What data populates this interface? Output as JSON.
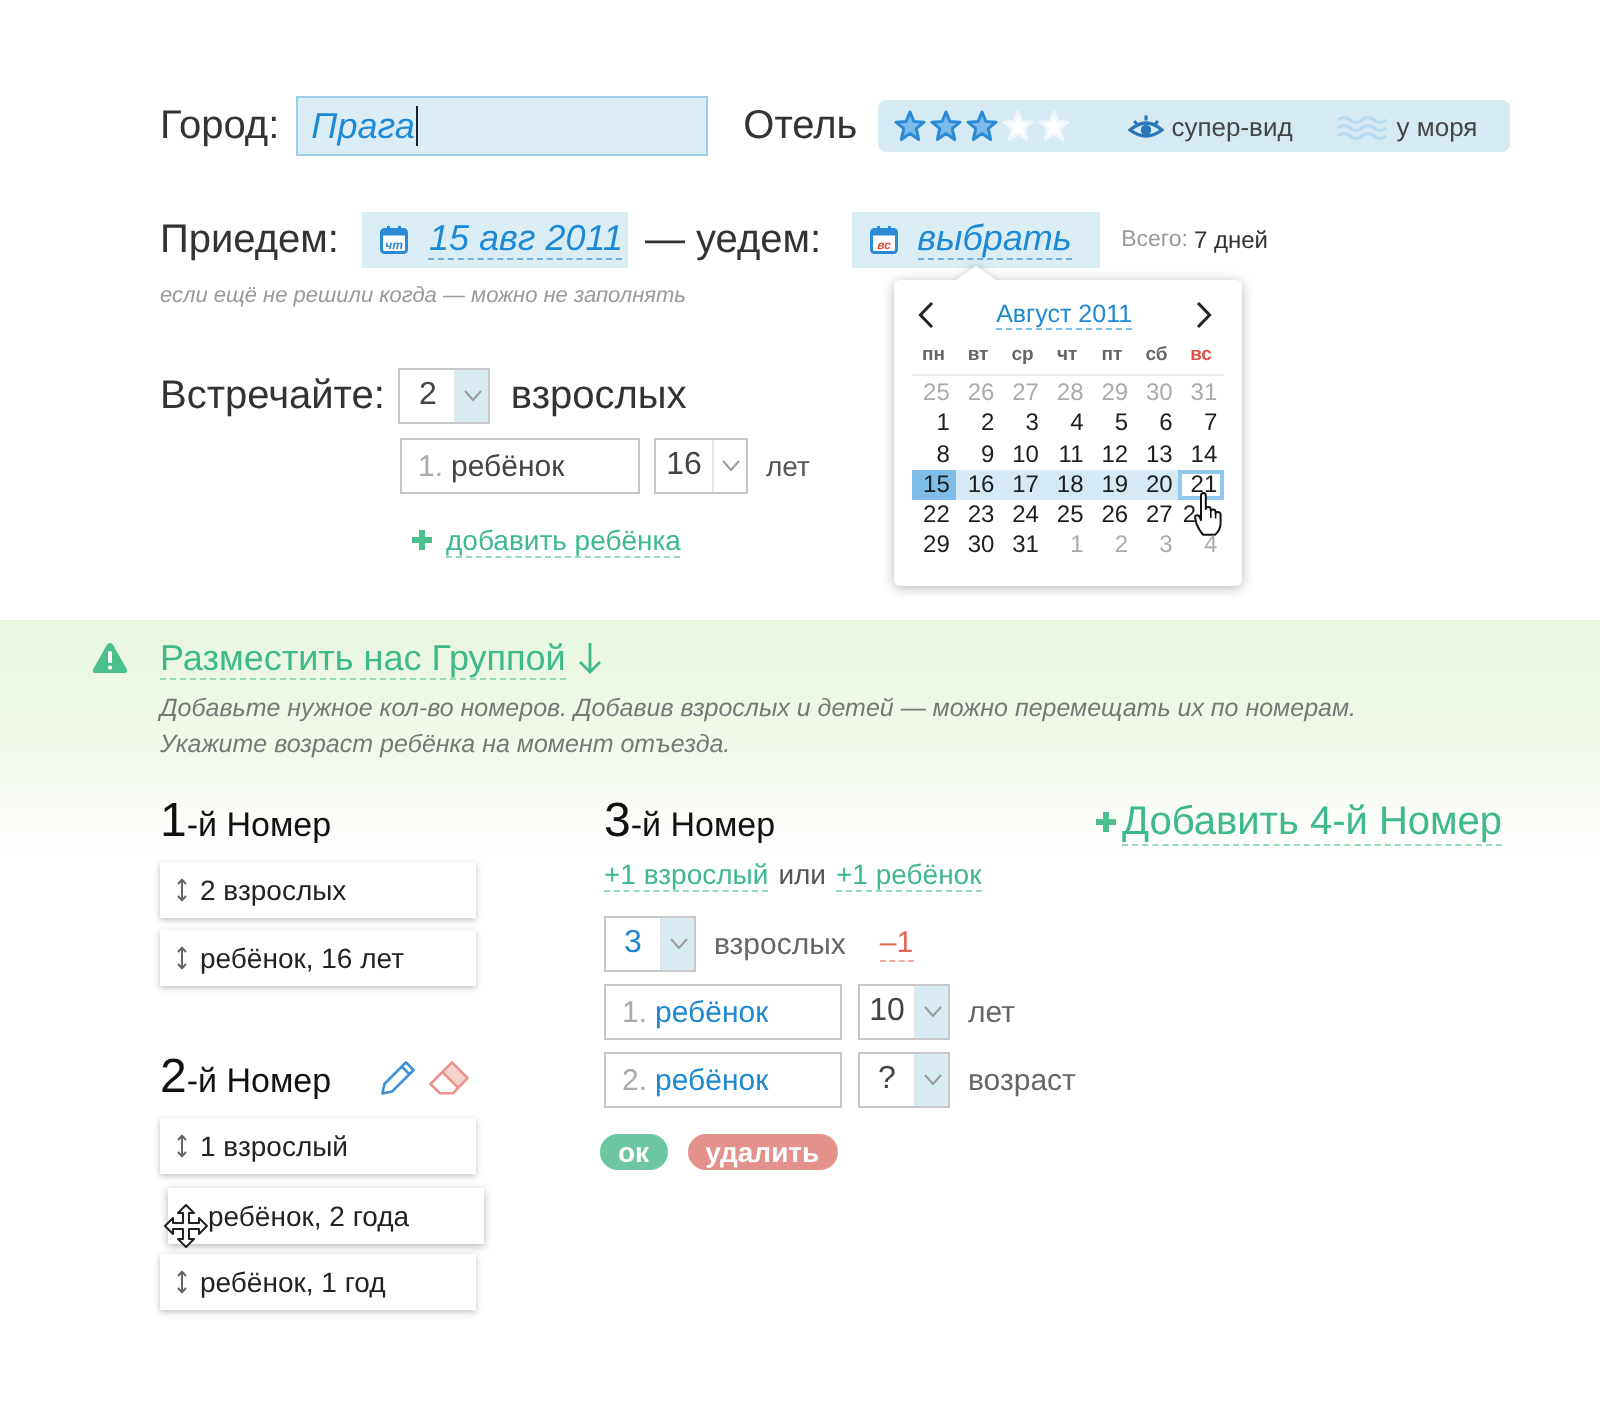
{
  "city": {
    "label": "Город:",
    "value": "Прага",
    "focused": true
  },
  "hotel": {
    "label": "Отель",
    "stars": 3,
    "filters": [
      {
        "kind": "view",
        "label": "супер-вид",
        "on": true
      },
      {
        "kind": "sea",
        "label": "у моря",
        "on": false
      }
    ]
  },
  "dates": {
    "arrive_label": "Приедем:",
    "arrive": {
      "weekday": "чт",
      "weekend": false,
      "value": "15 авг 2011"
    },
    "leave_label": "— уедем:",
    "leave": {
      "weekday": "вс",
      "weekend": true,
      "value": "выбрать"
    },
    "total_label": "Всего:",
    "total": "7 дней",
    "hint": "если ещё не решили когда — можно не заполнять"
  },
  "calendar": {
    "month": "Август 2011",
    "weekdays": [
      {
        "label": "пн",
        "weekend": false
      },
      {
        "label": "вт",
        "weekend": false
      },
      {
        "label": "ср",
        "weekend": false
      },
      {
        "label": "чт",
        "weekend": false
      },
      {
        "label": "пт",
        "weekend": false
      },
      {
        "label": "сб",
        "weekend": false
      },
      {
        "label": "вс",
        "weekend": true
      }
    ],
    "weeks": [
      [
        {
          "day": "25",
          "other_month": true,
          "selected": false,
          "in_range": false,
          "hovered": false,
          "cursor": false
        },
        {
          "day": "26",
          "other_month": true,
          "selected": false,
          "in_range": false,
          "hovered": false,
          "cursor": false
        },
        {
          "day": "27",
          "other_month": true,
          "selected": false,
          "in_range": false,
          "hovered": false,
          "cursor": false
        },
        {
          "day": "28",
          "other_month": true,
          "selected": false,
          "in_range": false,
          "hovered": false,
          "cursor": false
        },
        {
          "day": "29",
          "other_month": true,
          "selected": false,
          "in_range": false,
          "hovered": false,
          "cursor": false
        },
        {
          "day": "30",
          "other_month": true,
          "selected": false,
          "in_range": false,
          "hovered": false,
          "cursor": false
        },
        {
          "day": "31",
          "other_month": true,
          "selected": false,
          "in_range": false,
          "hovered": false,
          "cursor": false
        }
      ],
      [
        {
          "day": "1",
          "other_month": false,
          "selected": false,
          "in_range": false,
          "hovered": false,
          "cursor": false
        },
        {
          "day": "2",
          "other_month": false,
          "selected": false,
          "in_range": false,
          "hovered": false,
          "cursor": false
        },
        {
          "day": "3",
          "other_month": false,
          "selected": false,
          "in_range": false,
          "hovered": false,
          "cursor": false
        },
        {
          "day": "4",
          "other_month": false,
          "selected": false,
          "in_range": false,
          "hovered": false,
          "cursor": false
        },
        {
          "day": "5",
          "other_month": false,
          "selected": false,
          "in_range": false,
          "hovered": false,
          "cursor": false
        },
        {
          "day": "6",
          "other_month": false,
          "selected": false,
          "in_range": false,
          "hovered": false,
          "cursor": false
        },
        {
          "day": "7",
          "other_month": false,
          "selected": false,
          "in_range": false,
          "hovered": false,
          "cursor": false
        }
      ],
      [
        {
          "day": "8",
          "other_month": false,
          "selected": false,
          "in_range": false,
          "hovered": false,
          "cursor": false
        },
        {
          "day": "9",
          "other_month": false,
          "selected": false,
          "in_range": false,
          "hovered": false,
          "cursor": false
        },
        {
          "day": "10",
          "other_month": false,
          "selected": false,
          "in_range": false,
          "hovered": false,
          "cursor": false
        },
        {
          "day": "11",
          "other_month": false,
          "selected": false,
          "in_range": false,
          "hovered": false,
          "cursor": false
        },
        {
          "day": "12",
          "other_month": false,
          "selected": false,
          "in_range": false,
          "hovered": false,
          "cursor": false
        },
        {
          "day": "13",
          "other_month": false,
          "selected": false,
          "in_range": false,
          "hovered": false,
          "cursor": false
        },
        {
          "day": "14",
          "other_month": false,
          "selected": false,
          "in_range": false,
          "hovered": false,
          "cursor": false
        }
      ],
      [
        {
          "day": "15",
          "other_month": false,
          "selected": true,
          "in_range": false,
          "hovered": false,
          "cursor": false
        },
        {
          "day": "16",
          "other_month": false,
          "selected": false,
          "in_range": true,
          "hovered": false,
          "cursor": false
        },
        {
          "day": "17",
          "other_month": false,
          "selected": false,
          "in_range": true,
          "hovered": false,
          "cursor": false
        },
        {
          "day": "18",
          "other_month": false,
          "selected": false,
          "in_range": true,
          "hovered": false,
          "cursor": false
        },
        {
          "day": "19",
          "other_month": false,
          "selected": false,
          "in_range": true,
          "hovered": false,
          "cursor": false
        },
        {
          "day": "20",
          "other_month": false,
          "selected": false,
          "in_range": true,
          "hovered": false,
          "cursor": false
        },
        {
          "day": "21",
          "other_month": false,
          "selected": false,
          "in_range": false,
          "hovered": true,
          "cursor": false
        }
      ],
      [
        {
          "day": "22",
          "other_month": false,
          "selected": false,
          "in_range": false,
          "hovered": false,
          "cursor": false
        },
        {
          "day": "23",
          "other_month": false,
          "selected": false,
          "in_range": false,
          "hovered": false,
          "cursor": false
        },
        {
          "day": "24",
          "other_month": false,
          "selected": false,
          "in_range": false,
          "hovered": false,
          "cursor": false
        },
        {
          "day": "25",
          "other_month": false,
          "selected": false,
          "in_range": false,
          "hovered": false,
          "cursor": false
        },
        {
          "day": "26",
          "other_month": false,
          "selected": false,
          "in_range": false,
          "hovered": false,
          "cursor": false
        },
        {
          "day": "27",
          "other_month": false,
          "selected": false,
          "in_range": false,
          "hovered": false,
          "cursor": false
        },
        {
          "day": "2",
          "other_month": false,
          "selected": false,
          "in_range": false,
          "hovered": false,
          "cursor": true
        }
      ],
      [
        {
          "day": "29",
          "other_month": false,
          "selected": false,
          "in_range": false,
          "hovered": false,
          "cursor": false
        },
        {
          "day": "30",
          "other_month": false,
          "selected": false,
          "in_range": false,
          "hovered": false,
          "cursor": false
        },
        {
          "day": "31",
          "other_month": false,
          "selected": false,
          "in_range": false,
          "hovered": false,
          "cursor": false
        },
        {
          "day": "1",
          "other_month": true,
          "selected": false,
          "in_range": false,
          "hovered": false,
          "cursor": false
        },
        {
          "day": "2",
          "other_month": true,
          "selected": false,
          "in_range": false,
          "hovered": false,
          "cursor": false
        },
        {
          "day": "3",
          "other_month": true,
          "selected": false,
          "in_range": false,
          "hovered": false,
          "cursor": false
        },
        {
          "day": "4",
          "other_month": true,
          "selected": false,
          "in_range": false,
          "hovered": false,
          "cursor": false
        }
      ]
    ]
  },
  "travellers": {
    "label": "Встречайте:",
    "adults": {
      "value": "2",
      "accent": false,
      "highlighted": true
    },
    "adults_label": "взрослых",
    "children": [
      {
        "number": "1.",
        "name": "ребёнок",
        "accent": false,
        "age": {
          "value": "16",
          "accent": false,
          "highlighted": false
        },
        "age_label": "лет"
      }
    ],
    "add_child": "добавить ребёнка"
  },
  "group": {
    "title": "Разместить нас Группой",
    "description": [
      "Добавьте нужное кол-во номеров. Добавив взрослых и детей — можно перемещать их по номерам.",
      "Укажите возраст ребёнка на момент отъезда."
    ]
  },
  "rooms": [
    {
      "kind": "view",
      "number": "1",
      "title": "-й Номер",
      "guests": [
        {
          "label": "2 взрослых",
          "dragging": false
        },
        {
          "label": "ребёнок, 16 лет",
          "dragging": false
        }
      ]
    },
    {
      "kind": "view",
      "number": "2",
      "title": "-й Номер",
      "hovered": true,
      "guests": [
        {
          "label": "1 взрослый",
          "dragging": false
        },
        {
          "label": "ребёнок, 2 года",
          "dragging": true
        },
        {
          "label": "ребёнок, 1 год",
          "dragging": false
        }
      ]
    },
    {
      "kind": "edit",
      "number": "3",
      "title": "-й Номер",
      "add_adult": "+1 взрослый",
      "or": "или",
      "add_child": "+1 ребёнок",
      "adults": {
        "value": "3",
        "accent": true,
        "highlighted": true
      },
      "adults_label": "взрослых",
      "remove_adult": "–1",
      "children": [
        {
          "number": "1.",
          "name": "ребёнок",
          "accent": true,
          "age": {
            "value": "10",
            "accent": false,
            "highlighted": true
          },
          "age_label": "лет"
        },
        {
          "number": "2.",
          "name": "ребёнок",
          "accent": true,
          "age": {
            "value": "?",
            "accent": false,
            "highlighted": true
          },
          "age_label": "возраст"
        }
      ],
      "ok": "ок",
      "delete": "удалить"
    }
  ],
  "add_room": "Добавить 4-й Номер"
}
